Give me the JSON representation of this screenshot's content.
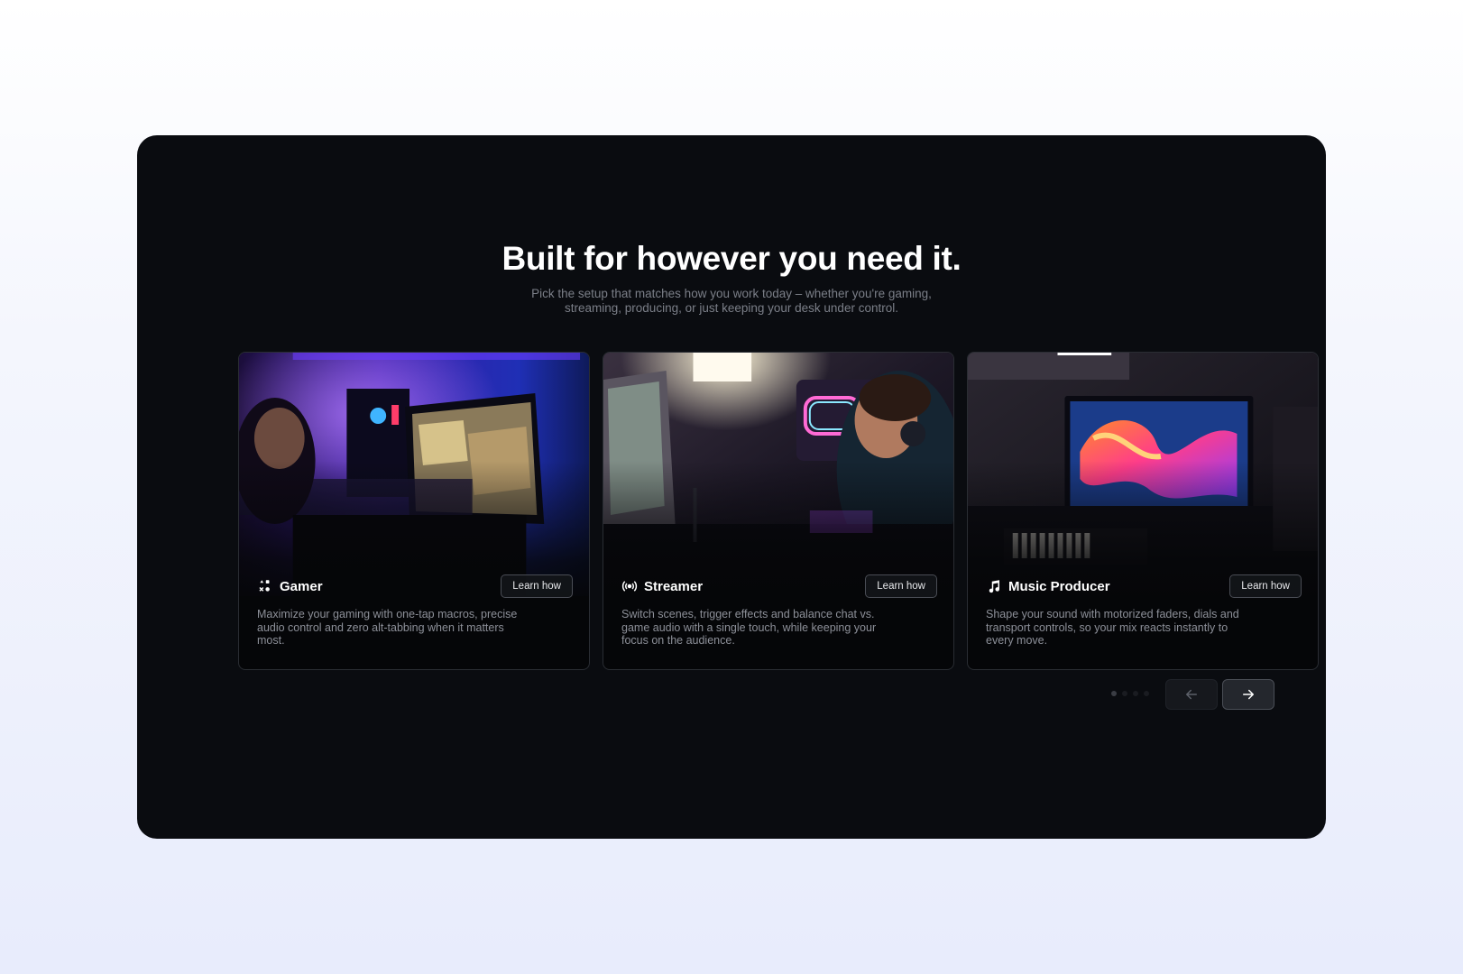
{
  "section": {
    "heading": "Built for however you need it.",
    "subtext": "Pick the setup that matches how you work today – whether you're gaming, streaming, producing, or just keeping your desk under control."
  },
  "cards": [
    {
      "title": "Gamer",
      "icon": "gamepad-icon",
      "button": "Learn how",
      "description": "Maximize your gaming with one-tap macros, precise audio control and zero alt-tabbing when it matters most."
    },
    {
      "title": "Streamer",
      "icon": "broadcast-icon",
      "button": "Learn how",
      "description": "Switch scenes, trigger effects and balance chat vs. game audio with a single touch, while keeping your focus on the audience."
    },
    {
      "title": "Music Producer",
      "icon": "music-note-icon",
      "button": "Learn how",
      "description": "Shape your sound with motorized faders, dials and transport controls, so your mix reacts instantly to every move."
    }
  ],
  "pagination": {
    "total": 4,
    "active": 0
  },
  "colors": {
    "panel": "#0a0c10",
    "accent_purple": "#5b2bd9",
    "text_primary": "#ffffff",
    "text_muted": "#8d9099"
  }
}
